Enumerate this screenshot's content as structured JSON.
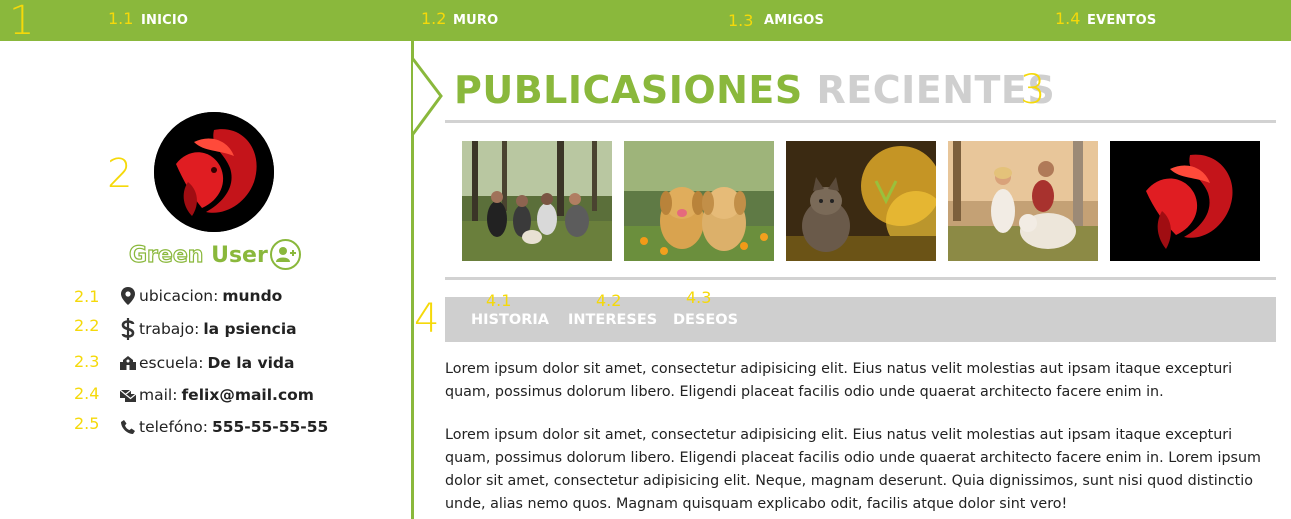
{
  "nav": {
    "items": [
      {
        "number": "1.1",
        "label": "INICIO"
      },
      {
        "number": "1.2",
        "label": "MURO"
      },
      {
        "number": "1.3",
        "label": "AMIGOS"
      },
      {
        "number": "1.4",
        "label": "EVENTOS"
      }
    ]
  },
  "section_markers": {
    "nav": "1",
    "profile": "2",
    "recent": "3",
    "tabs": "4"
  },
  "profile": {
    "name_first": "Green",
    "name_last": "User",
    "info": [
      {
        "number": "2.1",
        "icon": "map-marker-icon",
        "label": "ubicacion:",
        "value": "mundo"
      },
      {
        "number": "2.2",
        "icon": "dollar-icon",
        "label": "trabajo:",
        "value": "la psiencia"
      },
      {
        "number": "2.3",
        "icon": "school-icon",
        "label": "escuela:",
        "value": "De la vida"
      },
      {
        "number": "2.4",
        "icon": "mail-icon",
        "label": "mail:",
        "value": "felix@mail.com"
      },
      {
        "number": "2.5",
        "icon": "phone-icon",
        "label": "telefóno:",
        "value": "555-55-55-55"
      }
    ]
  },
  "recent": {
    "title_a": "PUBLICASIONES",
    "title_b": "RECIENTES",
    "photos": [
      "friends-picnic",
      "puppies",
      "cat-in-flowers",
      "couple-with-dog",
      "red-betta-fish"
    ]
  },
  "tabs": [
    {
      "number": "4.1",
      "label": "HISTORIA"
    },
    {
      "number": "4.2",
      "label": "INTERESES"
    },
    {
      "number": "4.3",
      "label": "DESEOS"
    }
  ],
  "content": {
    "paragraphs": [
      "Lorem ipsum dolor sit amet, consectetur adipisicing elit. Eius natus velit molestias aut ipsam itaque excepturi quam, possimus dolorum libero. Eligendi placeat facilis odio unde quaerat architecto facere enim in.",
      "Lorem ipsum dolor sit amet, consectetur adipisicing elit. Eius natus velit molestias aut ipsam itaque excepturi quam, possimus dolorum libero. Eligendi placeat facilis odio unde quaerat architecto facere enim in. Lorem ipsum dolor sit amet, consectetur adipisicing elit. Neque, magnam deserunt. Quia dignissimos, sunt nisi quod distinctio unde, alias nemo quos. Magnam quisquam explicabo odit, facilis atque dolor sint vero!"
    ]
  },
  "colors": {
    "accent": "#8ab83c",
    "annotation": "#f5d90a",
    "tab_bg": "#cfcfcf",
    "title_gray": "#cfcfcf"
  }
}
